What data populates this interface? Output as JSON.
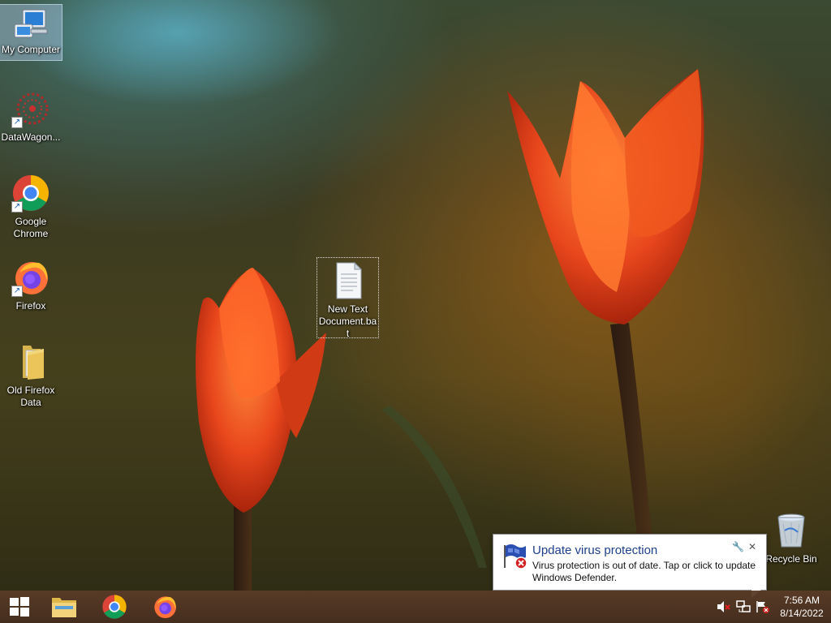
{
  "desktop": {
    "icons": [
      {
        "label": "My Computer",
        "icon": "computer-icon"
      },
      {
        "label": "DataWagon...",
        "icon": "datawagon-icon"
      },
      {
        "label": "Google Chrome",
        "icon": "chrome-icon"
      },
      {
        "label": "Firefox",
        "icon": "firefox-icon"
      },
      {
        "label": "Old Firefox Data",
        "icon": "folder-icon"
      },
      {
        "label": "New Text Document.bat",
        "icon": "text-document-icon"
      },
      {
        "label": "Recycle Bin",
        "icon": "recycle-bin-icon"
      }
    ]
  },
  "taskbar": {
    "pinned": [
      {
        "name": "start",
        "icon": "windows-logo-icon"
      },
      {
        "name": "file-explorer",
        "icon": "file-explorer-icon"
      },
      {
        "name": "chrome",
        "icon": "chrome-icon"
      },
      {
        "name": "firefox",
        "icon": "firefox-icon"
      }
    ],
    "tray": {
      "icons": [
        "volume-muted-icon",
        "network-icon",
        "action-center-icon"
      ],
      "time": "7:56 AM",
      "date": "8/14/2022"
    }
  },
  "notification": {
    "title": "Update virus protection",
    "message": "Virus protection is out of date. Tap or click to update Windows Defender.",
    "icon": "windows-defender-flag-icon",
    "accent": "#1e3f8a"
  },
  "colors": {
    "taskbar": "#5a3c28",
    "tulip": "#e8461c"
  }
}
